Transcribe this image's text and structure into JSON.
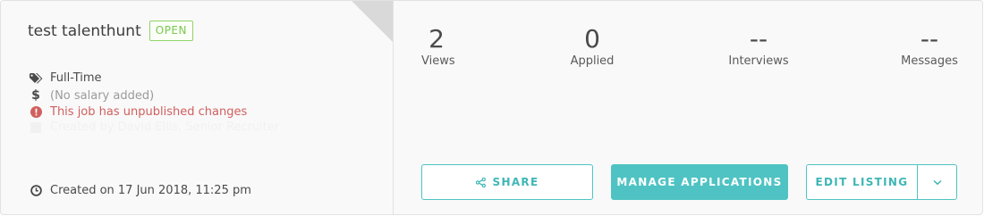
{
  "job": {
    "title": "test talenthunt",
    "status_badge": "OPEN",
    "employment_type": "Full-Time",
    "salary": "(No salary added)",
    "warning": "This job has unpublished changes",
    "faint_line": "Created by David Ellis, Senior Recruiter",
    "created": "Created on 17 Jun 2018, 11:25 pm"
  },
  "stats": [
    {
      "value": "2",
      "label": "Views"
    },
    {
      "value": "0",
      "label": "Applied"
    },
    {
      "value": "--",
      "label": "Interviews"
    },
    {
      "value": "--",
      "label": "Messages"
    }
  ],
  "actions": {
    "share_label": "SHARE",
    "manage_label": "MANAGE APPLICATIONS",
    "edit_label": "EDIT LISTING"
  },
  "icons": {
    "type": "tags-icon",
    "salary": "dollar-icon",
    "warning": "exclamation-circle-icon",
    "created": "clock-icon",
    "share": "share-icon",
    "dropdown": "chevron-down-icon"
  },
  "colors": {
    "accent": "#4fc3c3",
    "open_badge": "#7ac74f",
    "warning": "#d0605e"
  }
}
